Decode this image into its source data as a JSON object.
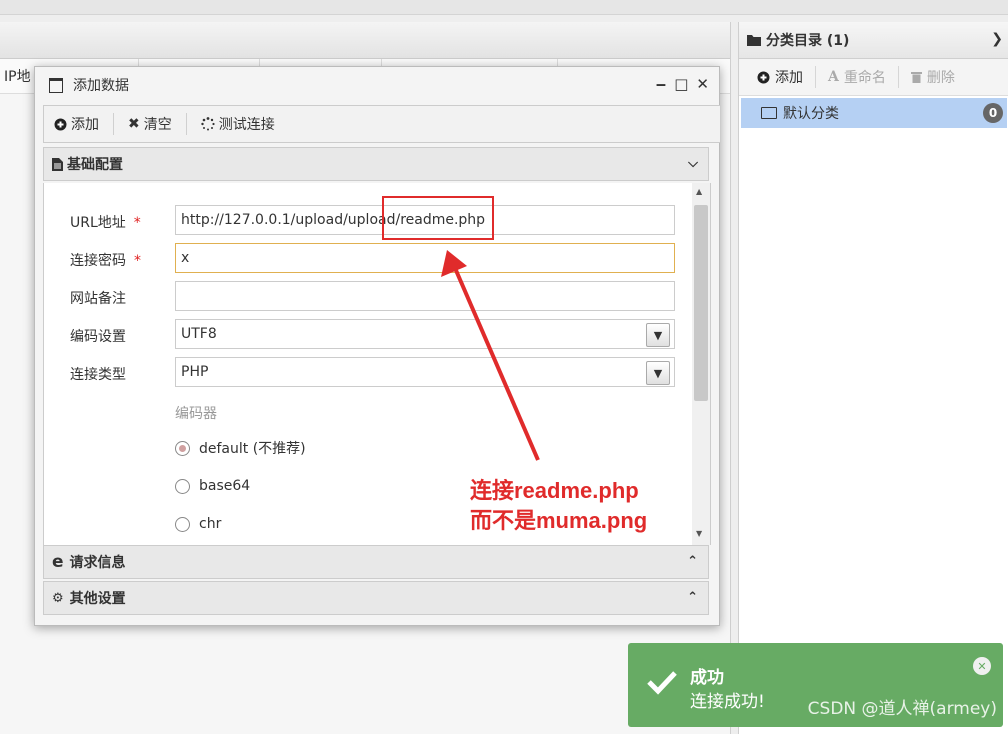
{
  "left_grid": {
    "ip_header": "IP地"
  },
  "category_panel": {
    "title": "分类目录 (1)",
    "toolbar": {
      "add": "添加",
      "rename": "重命名",
      "delete": "删除"
    },
    "items": [
      {
        "label": "默认分类",
        "count": "0"
      }
    ]
  },
  "dialog": {
    "title": "添加数据",
    "toolbar": {
      "add": "添加",
      "clear": "清空",
      "test": "测试连接"
    },
    "sections": {
      "basic": "基础配置",
      "request": "请求信息",
      "other": "其他设置"
    },
    "fields": {
      "url": {
        "label": "URL地址",
        "required": "*",
        "value": "http://127.0.0.1/upload/upload/readme.php"
      },
      "password": {
        "label": "连接密码",
        "required": "*",
        "value": "x"
      },
      "remark": {
        "label": "网站备注",
        "value": ""
      },
      "encoding": {
        "label": "编码设置",
        "value": "UTF8"
      },
      "type": {
        "label": "连接类型",
        "value": "PHP"
      }
    },
    "encoder": {
      "title": "编码器",
      "options": [
        "default (不推荐)",
        "base64",
        "chr"
      ],
      "selected": "default (不推荐)"
    }
  },
  "annotation": {
    "line1": "连接readme.php",
    "line2": "而不是muma.png",
    "color": "#e02b2b"
  },
  "toast": {
    "title": "成功",
    "message": "连接成功!",
    "color": "#67ab64"
  },
  "watermark": "CSDN @道人禅(armey)"
}
